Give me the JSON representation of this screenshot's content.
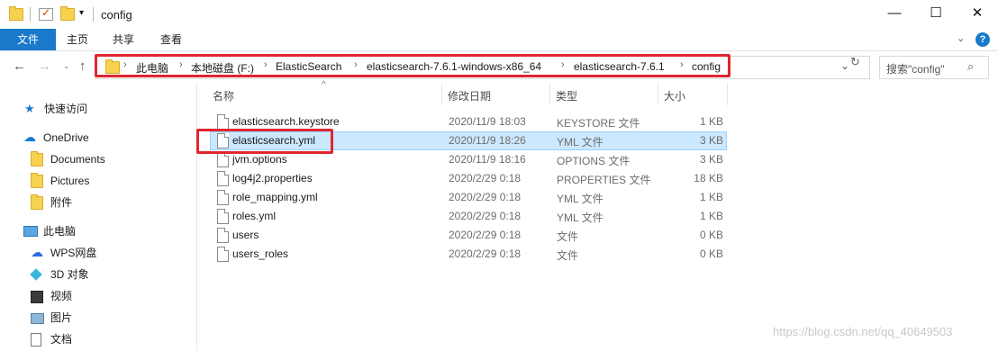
{
  "window": {
    "title": "config",
    "minimize": "—",
    "maximize": "☐",
    "close": "✕"
  },
  "ribbon": {
    "tabs": [
      "文件",
      "主页",
      "共享",
      "查看"
    ]
  },
  "address": {
    "crumbs": [
      "此电脑",
      "本地磁盘 (F:)",
      "ElasticSearch",
      "elasticsearch-7.6.1-windows-x86_64",
      "elasticsearch-7.6.1",
      "config"
    ],
    "search_placeholder": "搜索\"config\""
  },
  "nav": {
    "quick_access": "快速访问",
    "onedrive": "OneDrive",
    "documents": "Documents",
    "pictures": "Pictures",
    "attachments": "附件",
    "this_pc": "此电脑",
    "wps": "WPS网盘",
    "objects3d": "3D 对象",
    "videos": "视频",
    "images": "图片",
    "docs": "文档"
  },
  "columns": {
    "name": "名称",
    "date": "修改日期",
    "type": "类型",
    "size": "大小"
  },
  "files": [
    {
      "name": "elasticsearch.keystore",
      "date": "2020/11/9 18:03",
      "type": "KEYSTORE 文件",
      "size": "1 KB"
    },
    {
      "name": "elasticsearch.yml",
      "date": "2020/11/9 18:26",
      "type": "YML 文件",
      "size": "3 KB"
    },
    {
      "name": "jvm.options",
      "date": "2020/11/9 18:16",
      "type": "OPTIONS 文件",
      "size": "3 KB"
    },
    {
      "name": "log4j2.properties",
      "date": "2020/2/29 0:18",
      "type": "PROPERTIES 文件",
      "size": "18 KB"
    },
    {
      "name": "role_mapping.yml",
      "date": "2020/2/29 0:18",
      "type": "YML 文件",
      "size": "1 KB"
    },
    {
      "name": "roles.yml",
      "date": "2020/2/29 0:18",
      "type": "YML 文件",
      "size": "1 KB"
    },
    {
      "name": "users",
      "date": "2020/2/29 0:18",
      "type": "文件",
      "size": "0 KB"
    },
    {
      "name": "users_roles",
      "date": "2020/2/29 0:18",
      "type": "文件",
      "size": "0 KB"
    }
  ],
  "selected_file": "elasticsearch.yml",
  "watermark": "https://blog.csdn.net/qq_40649503",
  "colors": {
    "accent": "#1979ca",
    "selection": "#cce8ff",
    "highlight_box": "#e0262f"
  }
}
